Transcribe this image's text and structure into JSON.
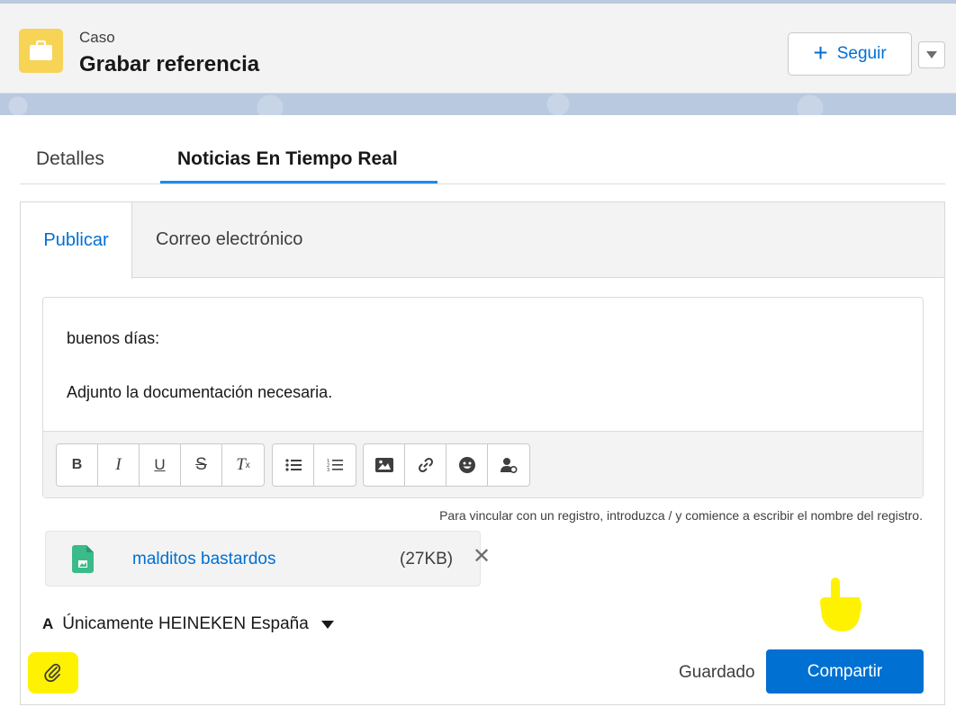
{
  "colors": {
    "brand": "#0070d2",
    "case_icon": "#f7d356",
    "highlight": "#fff200",
    "tab_underline": "#1b8ded"
  },
  "header": {
    "object_label": "Caso",
    "title": "Grabar referencia",
    "icon": "briefcase-icon",
    "follow_label": "Seguir",
    "follow_icon": "plus-icon",
    "more_icon": "chevron-down-icon"
  },
  "tabs": [
    {
      "label": "Detalles",
      "active": false
    },
    {
      "label": "Noticias En Tiempo Real",
      "active": true
    }
  ],
  "publisher": {
    "tabs": [
      {
        "label": "Publicar",
        "active": true
      },
      {
        "label": "Correo electrónico",
        "active": false
      }
    ],
    "body_lines": [
      "buenos días:",
      "",
      "Adjunto la documentación necesaria."
    ],
    "toolbar": {
      "groups": [
        [
          "bold-icon",
          "italic-icon",
          "underline-icon",
          "strikethrough-icon",
          "clear-format-icon"
        ],
        [
          "bulleted-list-icon",
          "numbered-list-icon"
        ],
        [
          "image-icon",
          "link-icon",
          "emoji-icon",
          "mention-icon"
        ]
      ]
    },
    "hint": "Para vincular con un registro, introduzca / y comience a escribir el nombre del registro.",
    "attachment": {
      "name": "malditos bastardos",
      "size": "(27KB)",
      "icon": "image-file-icon",
      "remove_icon": "close-icon"
    },
    "visibility": {
      "prefix": "A",
      "value": "Únicamente HEINEKEN España"
    },
    "attach_icon": "paperclip-icon",
    "saved_label": "Guardado",
    "share_label": "Compartir"
  },
  "annotation": {
    "icon": "pointing-hand-icon"
  }
}
